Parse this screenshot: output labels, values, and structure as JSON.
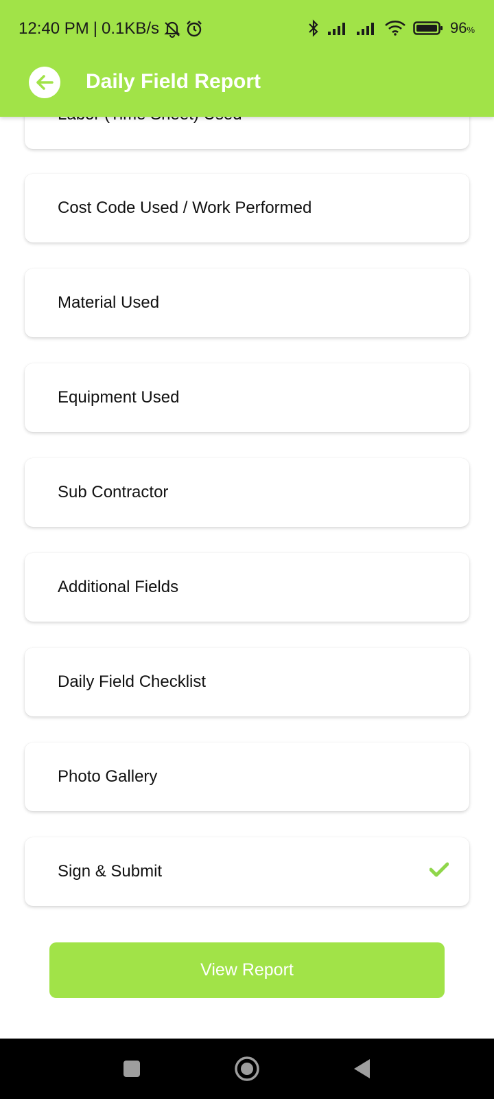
{
  "status_bar": {
    "time": "12:40 PM",
    "separator": "|",
    "network_speed": "0.1KB/s",
    "battery_percent": "96",
    "battery_unit": "%",
    "icons": [
      "mute-notifications-icon",
      "alarm-icon",
      "bluetooth-icon",
      "signal-icon",
      "signal-icon",
      "wifi-icon",
      "battery-icon"
    ]
  },
  "app_bar": {
    "title": "Daily Field Report",
    "back_icon": "back-arrow-icon"
  },
  "sections": [
    {
      "label": "Labor (Time Sheet) Used",
      "completed": false
    },
    {
      "label": "Cost Code Used / Work Performed",
      "completed": false
    },
    {
      "label": "Material Used",
      "completed": false
    },
    {
      "label": "Equipment Used",
      "completed": false
    },
    {
      "label": "Sub Contractor",
      "completed": false
    },
    {
      "label": "Additional Fields",
      "completed": false
    },
    {
      "label": "Daily Field Checklist",
      "completed": false
    },
    {
      "label": "Photo Gallery",
      "completed": false
    },
    {
      "label": "Sign & Submit",
      "completed": true
    }
  ],
  "view_report_label": "View Report",
  "colors": {
    "accent": "#a1e348",
    "check": "#8fd64a",
    "nav_bar": "#000000"
  },
  "nav_bar": {
    "icons": [
      "recents-icon",
      "home-icon",
      "back-icon"
    ]
  }
}
